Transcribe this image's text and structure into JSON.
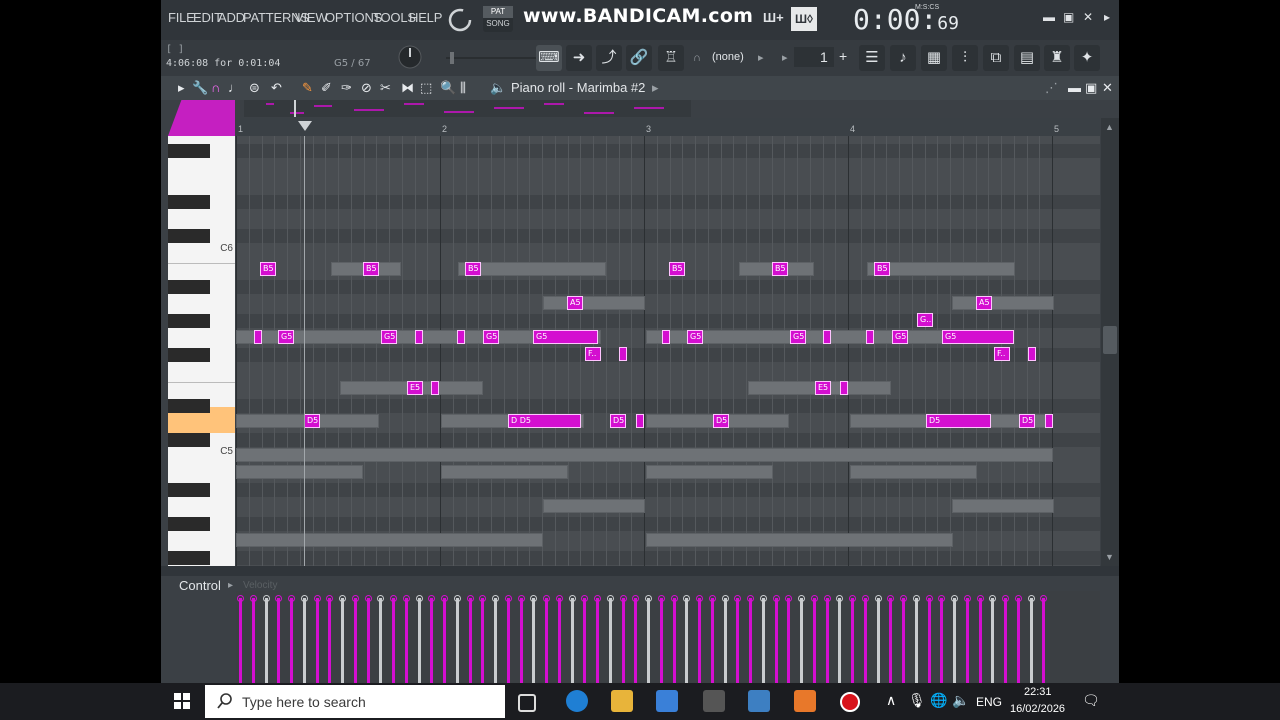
{
  "menu": [
    "FILE",
    "EDIT",
    "ADD",
    "PATTERNS",
    "VIEW",
    "OPTIONS",
    "TOOLS",
    "HELP"
  ],
  "overlay": {
    "brand": "www.BANDICAM.com",
    "pat_label": "PAT",
    "song_label": "SONG"
  },
  "clock": {
    "main": "0:00:",
    "sub": "69",
    "unit": "M:S:CS"
  },
  "hint": {
    "bracket": "[   ]",
    "text": "4:06:08 for 0:01:04",
    "note": "G5 / 67"
  },
  "toolbar": {
    "snap": "(none)",
    "step": "1"
  },
  "piano_roll": {
    "title": "Piano roll - Marimba #2",
    "bars": [
      "1",
      "2",
      "3",
      "4",
      "5"
    ],
    "octaves": [
      "C6",
      "C5"
    ]
  },
  "control": {
    "label": "Control",
    "param": "Velocity"
  },
  "notes": [
    {
      "label": "B5"
    },
    {
      "label": "B5"
    },
    {
      "label": "B5"
    },
    {
      "label": "B5"
    },
    {
      "label": "B5"
    },
    {
      "label": "B5"
    },
    {
      "label": "A5"
    },
    {
      "label": "A5"
    },
    {
      "label": "G.."
    },
    {
      "label": ""
    },
    {
      "label": "G5"
    },
    {
      "label": "G5"
    },
    {
      "label": ""
    },
    {
      "label": ""
    },
    {
      "label": "G5"
    },
    {
      "label": "G5"
    },
    {
      "label": ""
    },
    {
      "label": "G5"
    },
    {
      "label": "G5"
    },
    {
      "label": ""
    },
    {
      "label": ""
    },
    {
      "label": "G5"
    },
    {
      "label": "G5"
    },
    {
      "label": "F.."
    },
    {
      "label": ""
    },
    {
      "label": "F.."
    },
    {
      "label": ""
    },
    {
      "label": "E5"
    },
    {
      "label": ""
    },
    {
      "label": "E5"
    },
    {
      "label": ""
    },
    {
      "label": "D5"
    },
    {
      "label": "D D5"
    },
    {
      "label": "D5"
    },
    {
      "label": ""
    },
    {
      "label": "D5"
    },
    {
      "label": "D5"
    },
    {
      "label": "D5"
    },
    {
      "label": ""
    }
  ],
  "taskbar": {
    "search_placeholder": "Type here to search",
    "lang": "ENG",
    "time": "22:31",
    "date": "16/02/2026"
  },
  "colors": {
    "note": "#d40ed0",
    "accent": "#c51fc1",
    "window": "#3b4045"
  }
}
